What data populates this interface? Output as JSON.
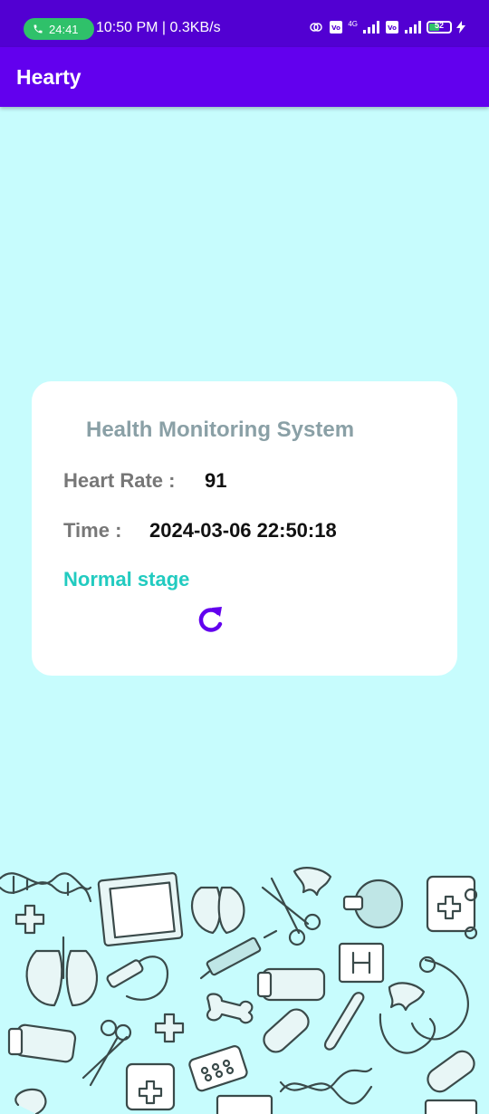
{
  "status_bar": {
    "call_timer": "24:41",
    "status_text": "10:50 PM | 0.3KB/s",
    "network_label": "4G",
    "battery_level": "52",
    "icons": [
      "phone-icon",
      "hotspot-icon",
      "volte-icon",
      "signal-icon",
      "battery-icon",
      "charging-icon"
    ]
  },
  "app_bar": {
    "title": "Hearty"
  },
  "card": {
    "title": "Health Monitoring System",
    "heart_rate_label": "Heart Rate :",
    "heart_rate_value": "91",
    "time_label": "Time :",
    "time_value": "2024-03-06 22:50:18",
    "stage": "Normal stage",
    "refresh_icon": "refresh-icon"
  },
  "colors": {
    "status_bar": "#5200d2",
    "app_bar": "#6200ee",
    "background": "#c7fcfd",
    "stage_text": "#22cbc0",
    "title_text": "#8aa0a6",
    "refresh_icon": "#6200ee"
  },
  "background_pattern": "medical-doodles-illustration"
}
